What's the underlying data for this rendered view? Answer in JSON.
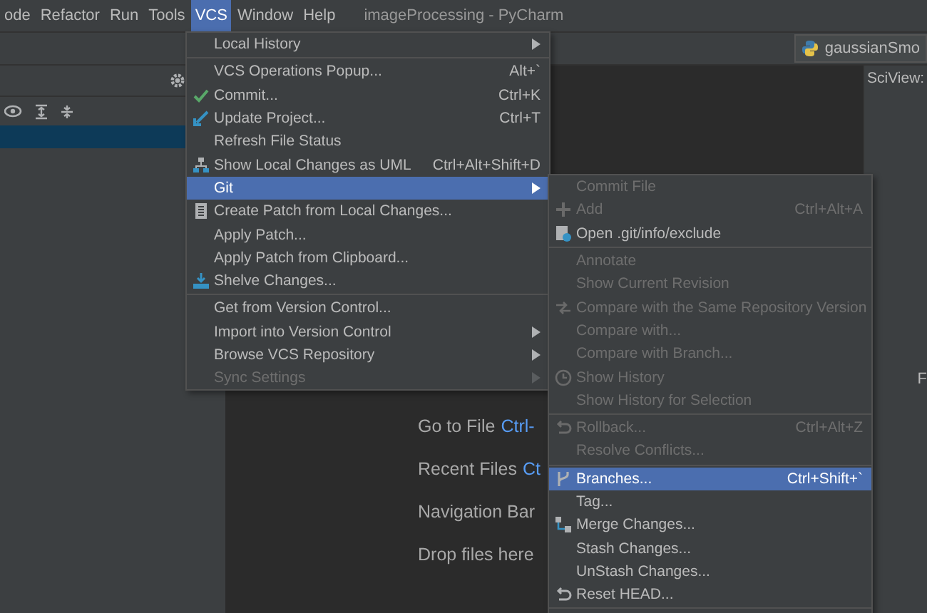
{
  "menubar": {
    "items": [
      {
        "label": "ode",
        "selected": false
      },
      {
        "label": "Refactor",
        "selected": false
      },
      {
        "label": "Run",
        "selected": false
      },
      {
        "label": "Tools",
        "selected": false
      },
      {
        "label": "VCS",
        "selected": true
      },
      {
        "label": "Window",
        "selected": false
      },
      {
        "label": "Help",
        "selected": false
      }
    ],
    "title": "imageProcessing - PyCharm"
  },
  "editor_tab": {
    "label": "gaussianSmo"
  },
  "sciview": {
    "title": "SciView:",
    "letter": "F"
  },
  "welcome": [
    {
      "label": "Go to File",
      "shortcut": "Ctrl-"
    },
    {
      "label": "Recent Files",
      "shortcut": "Ct"
    },
    {
      "label": "Navigation Bar"
    },
    {
      "label": "Drop files here"
    }
  ],
  "vcs_menu": {
    "items": [
      {
        "kind": "item",
        "label": "Local History",
        "submenu": true,
        "selected": false,
        "disabled": false
      },
      {
        "kind": "separator"
      },
      {
        "kind": "item",
        "label": "VCS Operations Popup...",
        "shortcut": "Alt+`",
        "selected": false,
        "disabled": false
      },
      {
        "kind": "item",
        "label": "Commit...",
        "shortcut": "Ctrl+K",
        "selected": false,
        "disabled": false
      },
      {
        "kind": "item",
        "label": "Update Project...",
        "shortcut": "Ctrl+T",
        "selected": false,
        "disabled": false
      },
      {
        "kind": "item",
        "label": "Refresh File Status",
        "selected": false,
        "disabled": false
      },
      {
        "kind": "item",
        "label": "Show Local Changes as UML",
        "shortcut": "Ctrl+Alt+Shift+D",
        "selected": false,
        "disabled": false
      },
      {
        "kind": "item",
        "label": "Git",
        "submenu": true,
        "selected": true,
        "disabled": false
      },
      {
        "kind": "item",
        "label": "Create Patch from Local Changes...",
        "selected": false,
        "disabled": false
      },
      {
        "kind": "item",
        "label": "Apply Patch...",
        "selected": false,
        "disabled": false
      },
      {
        "kind": "item",
        "label": "Apply Patch from Clipboard...",
        "selected": false,
        "disabled": false
      },
      {
        "kind": "item",
        "label": "Shelve Changes...",
        "selected": false,
        "disabled": false
      },
      {
        "kind": "separator"
      },
      {
        "kind": "item",
        "label": "Get from Version Control...",
        "selected": false,
        "disabled": false
      },
      {
        "kind": "item",
        "label": "Import into Version Control",
        "submenu": true,
        "selected": false,
        "disabled": false
      },
      {
        "kind": "item",
        "label": "Browse VCS Repository",
        "submenu": true,
        "selected": false,
        "disabled": false
      },
      {
        "kind": "item",
        "label": "Sync Settings",
        "submenu": true,
        "selected": false,
        "disabled": true
      }
    ]
  },
  "git_menu": {
    "items": [
      {
        "kind": "item",
        "label": "Commit File",
        "selected": false,
        "disabled": true
      },
      {
        "kind": "item",
        "label": "Add",
        "shortcut": "Ctrl+Alt+A",
        "selected": false,
        "disabled": true
      },
      {
        "kind": "item",
        "label": "Open .git/info/exclude",
        "selected": false,
        "disabled": false
      },
      {
        "kind": "separator"
      },
      {
        "kind": "item",
        "label": "Annotate",
        "selected": false,
        "disabled": true
      },
      {
        "kind": "item",
        "label": "Show Current Revision",
        "selected": false,
        "disabled": true
      },
      {
        "kind": "item",
        "label": "Compare with the Same Repository Version",
        "selected": false,
        "disabled": true
      },
      {
        "kind": "item",
        "label": "Compare with...",
        "selected": false,
        "disabled": true
      },
      {
        "kind": "item",
        "label": "Compare with Branch...",
        "selected": false,
        "disabled": true
      },
      {
        "kind": "item",
        "label": "Show History",
        "selected": false,
        "disabled": true
      },
      {
        "kind": "item",
        "label": "Show History for Selection",
        "selected": false,
        "disabled": true
      },
      {
        "kind": "separator"
      },
      {
        "kind": "item",
        "label": "Rollback...",
        "shortcut": "Ctrl+Alt+Z",
        "selected": false,
        "disabled": true
      },
      {
        "kind": "item",
        "label": "Resolve Conflicts...",
        "selected": false,
        "disabled": true
      },
      {
        "kind": "separator"
      },
      {
        "kind": "item",
        "label": "Branches...",
        "shortcut": "Ctrl+Shift+`",
        "selected": true,
        "disabled": false
      },
      {
        "kind": "item",
        "label": "Tag...",
        "selected": false,
        "disabled": false
      },
      {
        "kind": "item",
        "label": "Merge Changes...",
        "selected": false,
        "disabled": false
      },
      {
        "kind": "item",
        "label": "Stash Changes...",
        "selected": false,
        "disabled": false
      },
      {
        "kind": "item",
        "label": "UnStash Changes...",
        "selected": false,
        "disabled": false
      },
      {
        "kind": "item",
        "label": "Reset HEAD...",
        "selected": false,
        "disabled": false
      },
      {
        "kind": "separator"
      }
    ]
  }
}
